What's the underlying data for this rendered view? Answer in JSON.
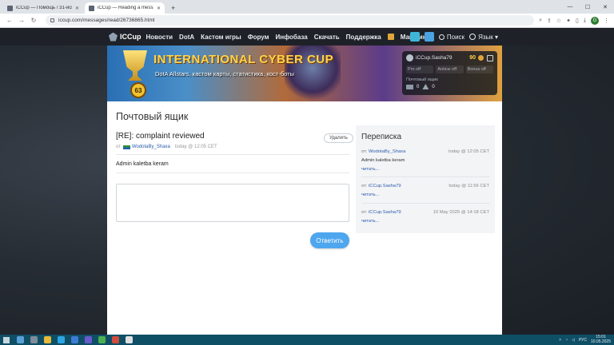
{
  "browser": {
    "tabs": [
      {
        "label": "iCCup — Помощь / 31-искусство",
        "active": false
      },
      {
        "label": "iCCup — Reading a message fr...",
        "active": true
      }
    ],
    "new_tab": "+",
    "url": "iccup.com/messages/read/26736865.html",
    "window_controls": {
      "minimize": "—",
      "maximize": "☐",
      "close": "✕"
    },
    "profile_initial": "G"
  },
  "site": {
    "logo_text": "ICCup",
    "menu": [
      "Новости",
      "DotA",
      "Кастом игры",
      "Форум",
      "Инфобаза",
      "Скачать",
      "Поддержка"
    ],
    "shop_label": "Магазин",
    "search_label": "Поиск",
    "lang_label": "Язык ▾"
  },
  "banner": {
    "title": "INTERNATIONAL CYBER CUP",
    "subtitle": "DotA Allstars, кастом карты, статистика, хост-боты",
    "level": "63"
  },
  "user_panel": {
    "username": "iCCup.Sasha79",
    "gold": "90",
    "pro": "Pro off",
    "anticw": "Anticw off",
    "bonus": "Bonus off",
    "mailbox_label": "Почтовый ящик",
    "mail_count": "0",
    "warn_count": "0"
  },
  "page": {
    "title": "Почтовый ящик",
    "message": {
      "subject": "[RE]: complaint reviewed",
      "delete_label": "Удалить",
      "from_prefix": "от",
      "author": "WodotaBy_Shaxa",
      "time": "today @ 12:05 CET",
      "body": "Admin kaletba keram"
    },
    "reply_placeholder": "",
    "send_label": "Ответить"
  },
  "conversation": {
    "title": "Переписка",
    "items": [
      {
        "from_prefix": "от:",
        "author": "WodotaBy_Shaxa",
        "time": "today @ 12:05 CET",
        "snippet": "Admin kaletba keram",
        "more": "читать..."
      },
      {
        "from_prefix": "от:",
        "author": "iCCup.Sasha79",
        "time": "today @ 11:56 CET",
        "snippet": "",
        "more": "читать..."
      },
      {
        "from_prefix": "от:",
        "author": "iCCup.Sasha79",
        "time": "10 May 2025 @ 14:18 CET",
        "snippet": "",
        "more": "читать..."
      }
    ]
  },
  "taskbar": {
    "time": "15:01",
    "date": "10.05.2025",
    "lang": "РУС"
  }
}
